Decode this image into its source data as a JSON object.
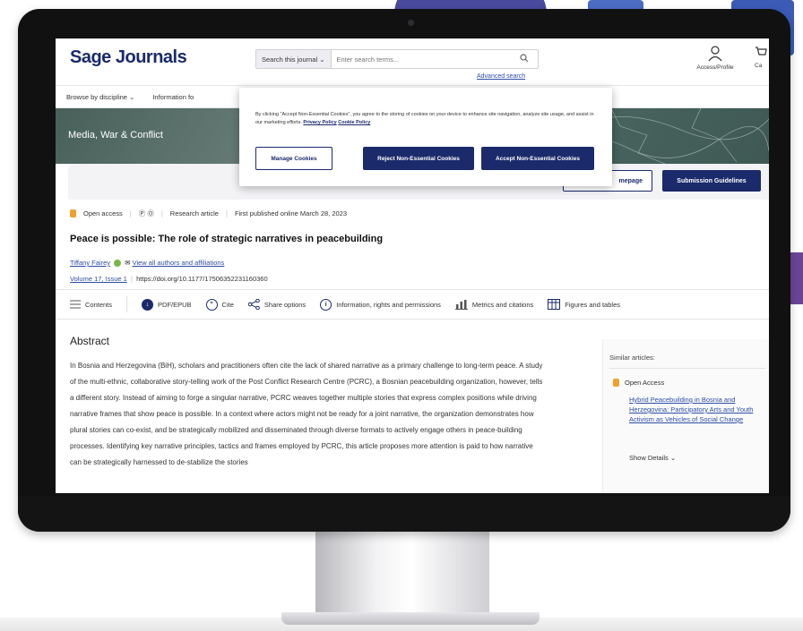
{
  "header": {
    "logo": "Sage Journals",
    "search_scope": "Search this journal",
    "search_placeholder": "Enter search terms...",
    "advanced_search": "Advanced search",
    "access_profile": "Access/Profile",
    "cart": "Ca"
  },
  "nav": {
    "items": [
      "Browse by discipline",
      "Information fo"
    ]
  },
  "journal": {
    "title": "Media, War & Conflict",
    "homepage_button": "mepage",
    "guidelines_button": "Submission Guidelines"
  },
  "cookie_banner": {
    "text": "By clicking \"Accept Non-Essential Cookies\", you agree to the storing of cookies on your device to enhance site navigation, analyze site usage, and assist in our marketing efforts.",
    "privacy_link": "Privacy Policy",
    "cookie_link": "Cookie Policy",
    "manage": "Manage Cookies",
    "reject": "Reject Non-Essential Cookies",
    "accept": "Accept Non-Essential Cookies"
  },
  "article": {
    "open_access": "Open access",
    "type": "Research article",
    "published": "First published online March 28, 2023",
    "title": "Peace is possible: The role of strategic narratives in peacebuilding",
    "author": "Tiffany Fairey",
    "all_authors": "View all authors and affiliations",
    "volume": "Volume 17, Issue 1",
    "doi": "https://doi.org/10.1177/17506352231160360"
  },
  "tools": {
    "contents": "Contents",
    "pdf": "PDF/EPUB",
    "cite": "Cite",
    "share": "Share options",
    "info": "Information, rights and permissions",
    "metrics": "Metrics and citations",
    "figures": "Figures and tables"
  },
  "abstract": {
    "heading": "Abstract",
    "text": "In Bosnia and Herzegovina (BiH), scholars and practitioners often cite the lack of shared narrative as a primary challenge to long-term peace. A study of the multi-ethnic, collaborative story-telling work of the Post Conflict Research Centre (PCRC), a Bosnian peacebuilding organization, however, tells a different story. Instead of aiming to forge a singular narrative, PCRC weaves together multiple stories that express complex positions while driving narrative frames that show peace is possible. In a context where actors might not be ready for a joint narrative, the organization demonstrates how plural stories can co-exist, and be strategically mobilized and disseminated through diverse formats to actively engage others in peace-building processes. Identifying key narrative principles, tactics and frames employed by PCRC, this article proposes more attention is paid to how narrative can be strategically harnessed to de-stabilize the stories"
  },
  "sidebar": {
    "similar_articles": "Similar articles:",
    "open_access": "Open Access",
    "link": "Hybrid Peacebuilding in Bosnia and Herzegovina: Participatory Arts and Youth Activism as Vehicles of Social Change",
    "show_details": "Show Details"
  }
}
